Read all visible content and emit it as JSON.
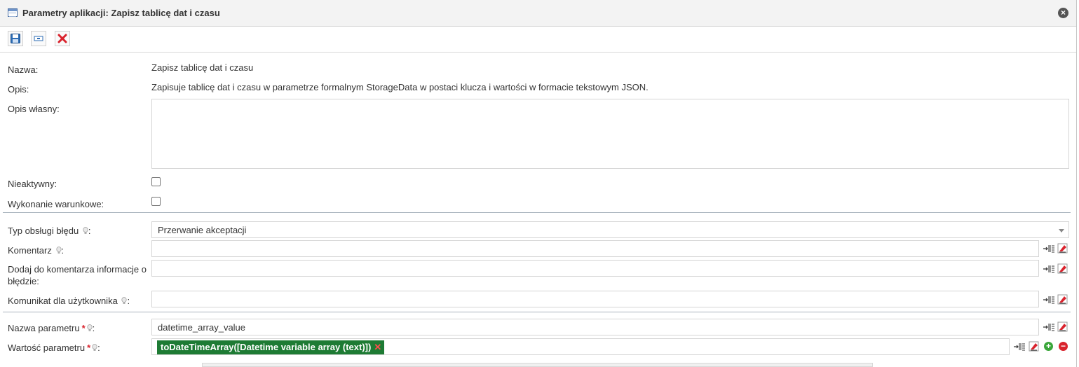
{
  "window": {
    "title": "Parametry aplikacji: Zapisz tablicę dat i czasu"
  },
  "icons": {
    "title": "table-icon",
    "close": "close-icon",
    "save": "save-icon",
    "edit": "edit-field-icon",
    "delete": "delete-icon",
    "hint": "lightbulb-icon",
    "insert": "insert-variable-icon",
    "clear": "clear-field-icon",
    "add": "add-icon",
    "remove": "remove-icon"
  },
  "colors": {
    "token_bg": "#1e7b34",
    "required": "#d9232d",
    "separator": "#a8b3bd"
  },
  "fields": {
    "name": {
      "label": "Nazwa:",
      "value": "Zapisz tablicę dat i czasu"
    },
    "description": {
      "label": "Opis:",
      "value": "Zapisuje tablicę dat i czasu w parametrze formalnym StorageData w postaci klucza i wartości w formacie tekstowym JSON."
    },
    "own_description": {
      "label": "Opis własny:",
      "value": ""
    },
    "inactive": {
      "label": "Nieaktywny:",
      "checked": false
    },
    "conditional": {
      "label": "Wykonanie warunkowe:",
      "checked": false
    },
    "error_type": {
      "label": "Typ obsługi błędu",
      "colon": ":",
      "value": "Przerwanie akceptacji"
    },
    "comment": {
      "label": "Komentarz",
      "colon": ":",
      "value": ""
    },
    "add_error_info": {
      "label": "Dodaj do komentarza informacje o błędzie:",
      "value": ""
    },
    "user_message": {
      "label": "Komunikat dla użytkownika",
      "colon": ":",
      "value": ""
    },
    "param_name": {
      "label": "Nazwa parametru",
      "required": "*",
      "colon": ":",
      "value": "datetime_array_value"
    },
    "param_value": {
      "label": "Wartość parametru",
      "required": "*",
      "colon": ":",
      "token": "toDateTimeArray([Datetime variable array (text)])",
      "token_remove": "✕"
    }
  }
}
